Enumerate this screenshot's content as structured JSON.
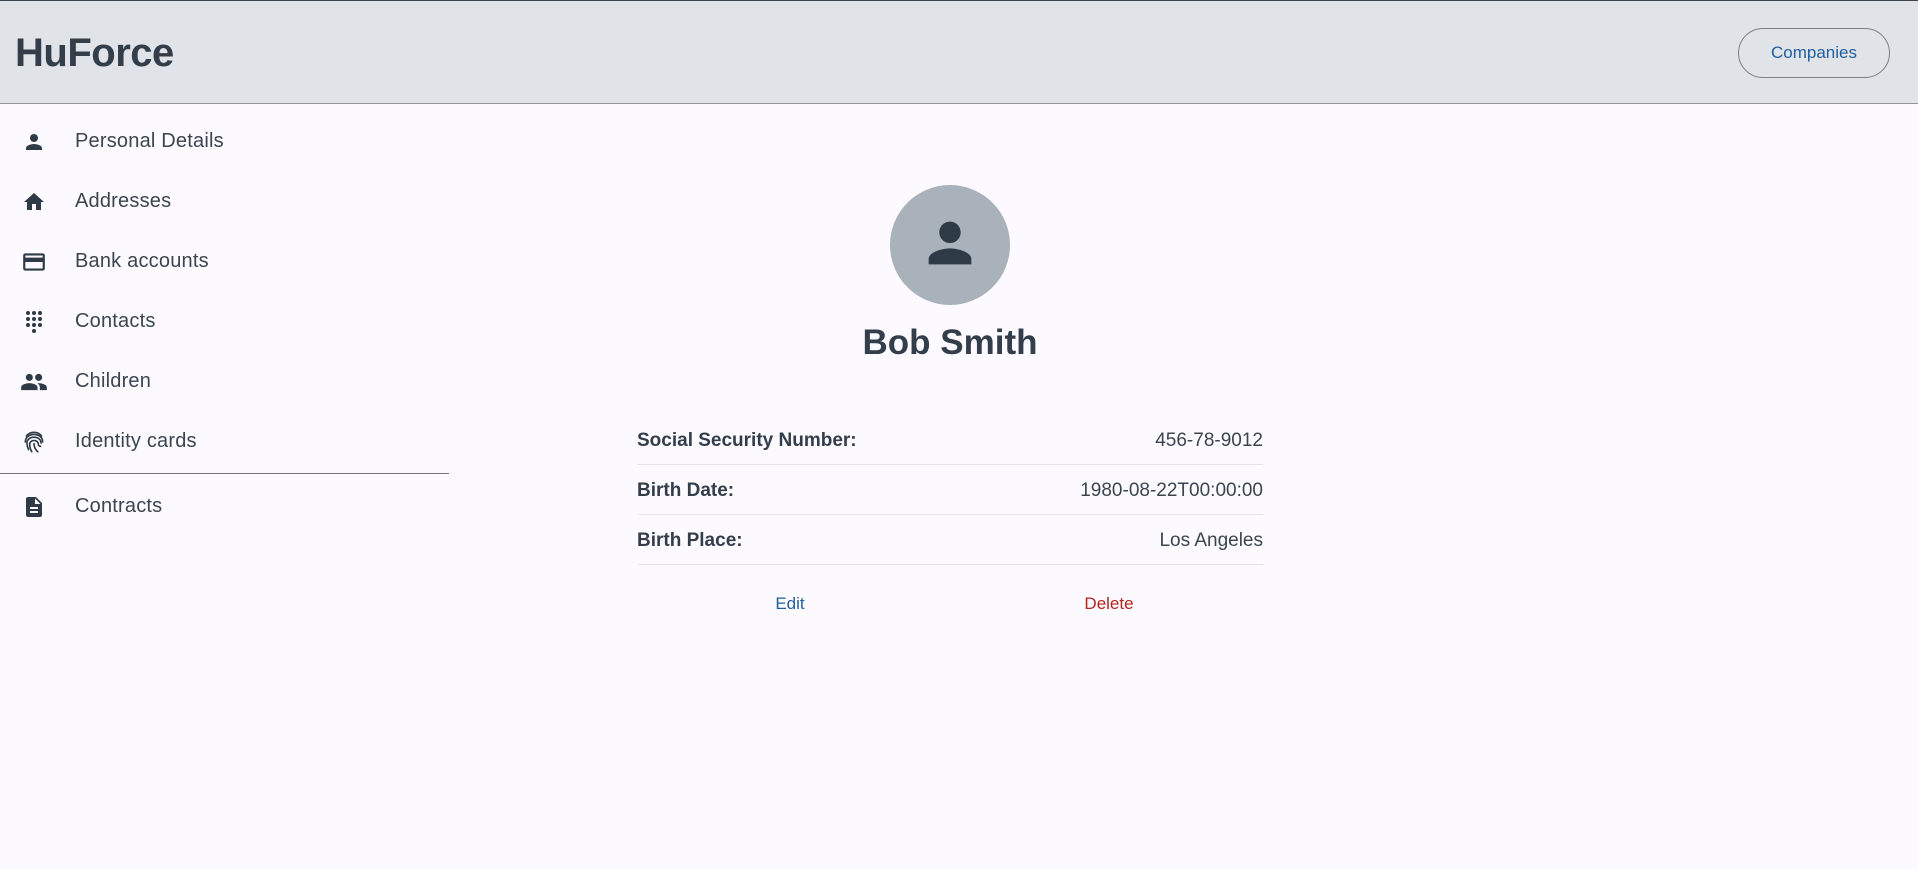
{
  "app": {
    "brand": "HuForce",
    "companies_label": "Companies"
  },
  "sidebar": {
    "items": [
      {
        "label": "Personal Details",
        "icon": "person-icon"
      },
      {
        "label": "Addresses",
        "icon": "home-icon"
      },
      {
        "label": "Bank accounts",
        "icon": "credit-card-icon"
      },
      {
        "label": "Contacts",
        "icon": "dialpad-icon"
      },
      {
        "label": "Children",
        "icon": "people-icon"
      },
      {
        "label": "Identity cards",
        "icon": "fingerprint-icon"
      },
      {
        "label": "Contracts",
        "icon": "document-icon"
      }
    ]
  },
  "profile": {
    "name": "Bob Smith",
    "avatar_icon": "person-icon",
    "details": [
      {
        "label": "Social Security Number:",
        "value": "456-78-9012"
      },
      {
        "label": "Birth Date:",
        "value": "1980-08-22T00:00:00"
      },
      {
        "label": "Birth Place:",
        "value": "Los Angeles"
      }
    ],
    "edit_label": "Edit",
    "delete_label": "Delete"
  },
  "colors": {
    "header_bg": "#e0e3e7",
    "page_bg": "#fcfaff",
    "primary": "#1f5f9e",
    "danger": "#b3261e",
    "avatar_bg": "#a9b1bb",
    "text": "#333e4a"
  }
}
